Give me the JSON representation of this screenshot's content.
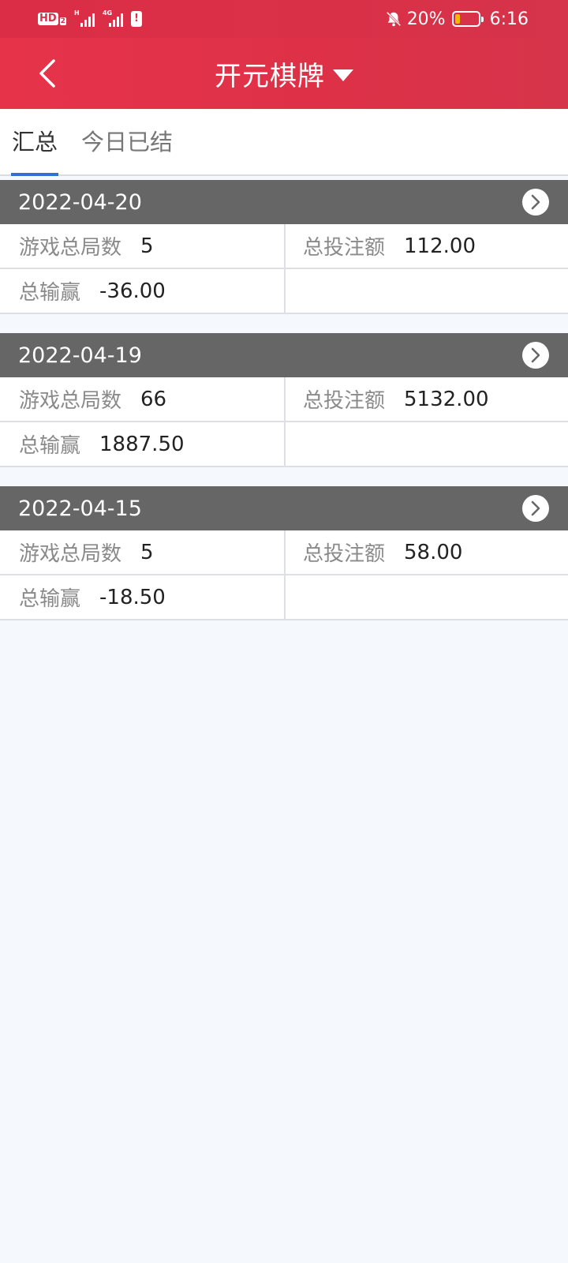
{
  "status_bar": {
    "hd_label": "HD",
    "hd_sub": "2",
    "signal1_tag": "H",
    "signal2_tag": "4G",
    "battery_percent": "20%",
    "time": "6:16"
  },
  "header": {
    "title": "开元棋牌",
    "back_icon": "chevron-left-icon",
    "dropdown_icon": "caret-down-icon"
  },
  "tabs": [
    {
      "label": "汇总",
      "active": true
    },
    {
      "label": "今日已结",
      "active": false
    }
  ],
  "labels": {
    "games": "游戏总局数",
    "bet": "总投注额",
    "winloss": "总输赢"
  },
  "records": [
    {
      "date": "2022-04-20",
      "games": "5",
      "bet": "112.00",
      "winloss": "-36.00"
    },
    {
      "date": "2022-04-19",
      "games": "66",
      "bet": "5132.00",
      "winloss": "1887.50"
    },
    {
      "date": "2022-04-15",
      "games": "5",
      "bet": "58.00",
      "winloss": "-18.50"
    }
  ],
  "colors": {
    "header_red": "#e6334a",
    "tab_indicator": "#2f6fd6",
    "record_header": "#666666",
    "page_bg": "#f5f9fd"
  }
}
